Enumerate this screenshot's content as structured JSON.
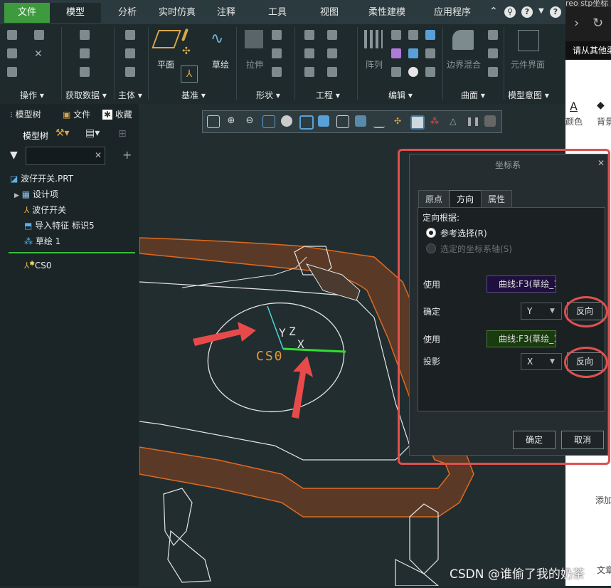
{
  "menu": {
    "tabs": [
      "文件",
      "模型",
      "分析",
      "实时仿真",
      "注释",
      "工具",
      "视图",
      "柔性建模",
      "应用程序"
    ]
  },
  "ribbon": {
    "groups": [
      "操作",
      "获取数据",
      "主体",
      "基准",
      "形状",
      "工程",
      "编辑",
      "曲面",
      "模型意图"
    ],
    "buttons": {
      "plane": "平面",
      "sketch": "草绘",
      "extrude": "拉伸",
      "pattern": "阵列",
      "boundary_blend": "边界混合",
      "component_interface": "元件界面"
    }
  },
  "left_panel": {
    "tabs": [
      "模型树",
      "文件",
      "收藏"
    ],
    "tree_label": "模型树",
    "search_placeholder": "",
    "items": [
      "波仔开关.PRT",
      "设计项",
      "波仔开关",
      "导入特征 标识5",
      "草绘 1",
      "CS0"
    ]
  },
  "viewport": {
    "axis_labels": {
      "cs": "CS0",
      "y": "Y",
      "z": "Z",
      "x": "X"
    }
  },
  "dialog": {
    "title": "坐标系",
    "tabs": [
      "原点",
      "方向",
      "属性"
    ],
    "active_tab": "方向",
    "orient_by_label": "定向根据:",
    "radio_ref": "参考选择(R)",
    "radio_sys": "选定的坐标系轴(S)",
    "use1_label": "使用",
    "use1_value": "曲线:F3(草绘_1",
    "determine_label": "确定",
    "determine_value": "Y",
    "reverse1": "反向",
    "use2_label": "使用",
    "use2_value": "曲线:F3(草绘_1",
    "project_label": "投影",
    "project_value": "X",
    "reverse2": "反向",
    "ok": "确定",
    "cancel": "取消"
  },
  "web": {
    "snippet_top": "reo stp坐标",
    "login_hint": "请从其他渠",
    "color_label": "颜色",
    "bg_label": "背景",
    "add_label": "添加",
    "article_label": "文章"
  },
  "watermark": "CSDN @谁偷了我的奶茶",
  "colors": {
    "accent_green": "#3d9b3d",
    "highlight_red": "#e05050",
    "model_orange": "#e06a20",
    "field_purple": "#1e0f3e",
    "field_green": "#1a3a10"
  }
}
